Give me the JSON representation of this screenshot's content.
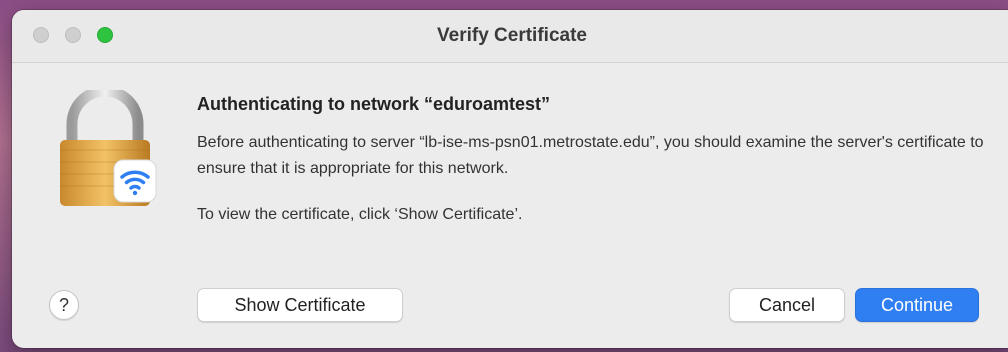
{
  "window": {
    "title": "Verify Certificate"
  },
  "dialog": {
    "heading": "Authenticating to network “eduroamtest”",
    "body_line1": "Before authenticating to server “lb-ise-ms-psn01.metrostate.edu”, you should examine the server's certificate to ensure that it is appropriate for this network.",
    "body_line2": "To view the certificate, click ‘Show Certificate’."
  },
  "buttons": {
    "help": "?",
    "show_certificate": "Show Certificate",
    "cancel": "Cancel",
    "continue": "Continue"
  },
  "icons": {
    "lock": "padlock-icon",
    "wifi": "wifi-icon"
  },
  "colors": {
    "accent": "#2f7ff3",
    "traffic_light_green": "#2ec43f"
  }
}
